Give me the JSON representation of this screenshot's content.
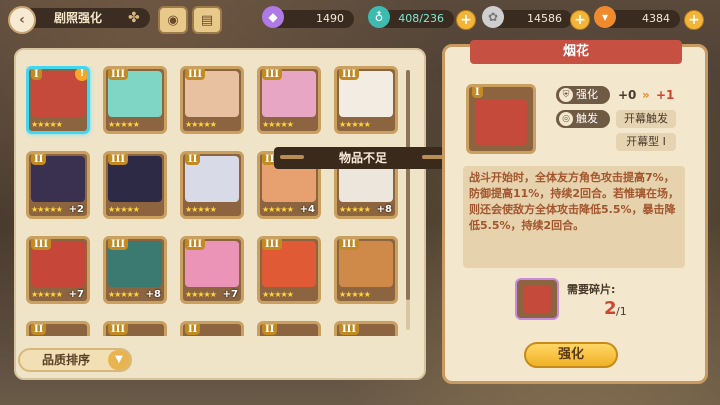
{
  "header": {
    "title": "剧照强化",
    "resources": [
      {
        "name": "gem",
        "value": "1490",
        "icon": "gem-icon",
        "color": "#b07ae6"
      },
      {
        "name": "stamina",
        "value": "408/236",
        "icon": "potion-icon",
        "color": "#3dbbb0"
      },
      {
        "name": "coin",
        "value": "14586",
        "icon": "coin-icon",
        "color": "#cfcfcf"
      },
      {
        "name": "carrot",
        "value": "4384",
        "icon": "carrot-icon",
        "color": "#f08a2c"
      }
    ]
  },
  "cards": [
    {
      "tier": "I",
      "stars": "★★★★★",
      "bonus": "",
      "selected": true,
      "warn": "!",
      "color": "#c64a3c"
    },
    {
      "tier": "III",
      "stars": "★★★★★",
      "bonus": "",
      "color": "#7fd6c4"
    },
    {
      "tier": "III",
      "stars": "★★★★★",
      "bonus": "",
      "color": "#e8c2a0"
    },
    {
      "tier": "III",
      "stars": "★★★★★",
      "bonus": "",
      "color": "#e6a6c4"
    },
    {
      "tier": "III",
      "stars": "★★★★★",
      "bonus": "",
      "color": "#f2ece2"
    },
    {
      "tier": "II",
      "stars": "★★★★★",
      "bonus": "+2",
      "color": "#3a3050"
    },
    {
      "tier": "III",
      "stars": "★★★★★",
      "bonus": "",
      "color": "#2c2a44"
    },
    {
      "tier": "II",
      "stars": "★★★★★",
      "bonus": "",
      "color": "#d8dae8"
    },
    {
      "tier": "II",
      "stars": "★★★★★",
      "bonus": "+4",
      "color": "#e7a070"
    },
    {
      "tier": "II",
      "stars": "★★★★★",
      "bonus": "+8",
      "color": "#ece6dc"
    },
    {
      "tier": "III",
      "stars": "★★★★★",
      "bonus": "+7",
      "color": "#c6463a"
    },
    {
      "tier": "III",
      "stars": "★★★★★",
      "bonus": "+8",
      "color": "#3a7a70"
    },
    {
      "tier": "III",
      "stars": "★★★★★",
      "bonus": "+7",
      "color": "#ec94b8"
    },
    {
      "tier": "III",
      "stars": "★★★★★",
      "bonus": "",
      "color": "#e05a36"
    },
    {
      "tier": "III",
      "stars": "★★★★★",
      "bonus": "",
      "color": "#cf8a4a"
    },
    {
      "tier": "II",
      "stars": "",
      "bonus": "",
      "color": "#8c6440"
    },
    {
      "tier": "III",
      "stars": "",
      "bonus": "",
      "color": "#8c6440"
    },
    {
      "tier": "II",
      "stars": "",
      "bonus": "",
      "color": "#8c6440"
    },
    {
      "tier": "II",
      "stars": "",
      "bonus": "",
      "color": "#8c6440"
    },
    {
      "tier": "III",
      "stars": "",
      "bonus": "",
      "color": "#8c6440"
    }
  ],
  "tooltip": "物品不足",
  "sort_label": "品质排序",
  "detail": {
    "name": "烟花",
    "tier": "I",
    "enhance_label": "强化",
    "enhance_from": "+0",
    "enhance_to": "+1",
    "trigger_label": "触发",
    "trigger_value": "开幕触发",
    "type_value": "开幕型 I",
    "description": "战斗开始时，全体友方角色攻击提高7%，防御提高11%，持续2回合。若惟璃在场，则还会使敌方全体攻击降低5.5%，暴击降低5.5%，持续2回合。",
    "fragments_label": "需要碎片:",
    "fragments_have": "2",
    "fragments_need": "/1",
    "upgrade_button": "强化"
  },
  "colors": {
    "accent": "#c65042",
    "panel": "#efe3c8",
    "select": "#42d6f0"
  }
}
